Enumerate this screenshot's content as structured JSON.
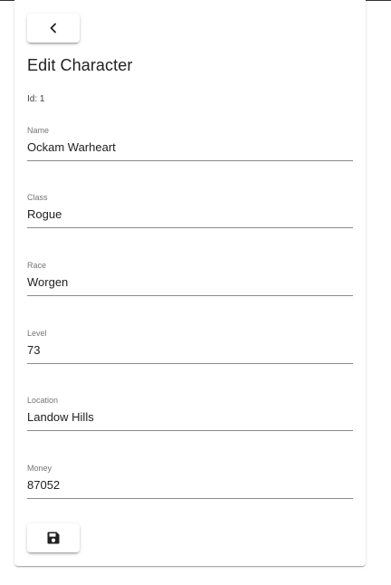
{
  "form": {
    "title": "Edit Character",
    "id_text": "Id: 1",
    "fields": [
      {
        "label": "Name",
        "value": "Ockam Warheart"
      },
      {
        "label": "Class",
        "value": "Rogue"
      },
      {
        "label": "Race",
        "value": "Worgen"
      },
      {
        "label": "Level",
        "value": "73"
      },
      {
        "label": "Location",
        "value": "Landow Hills"
      },
      {
        "label": "Money",
        "value": "87052"
      }
    ]
  },
  "icons": {
    "back": "chevron-left-icon",
    "save": "floppy-disk-icon"
  }
}
